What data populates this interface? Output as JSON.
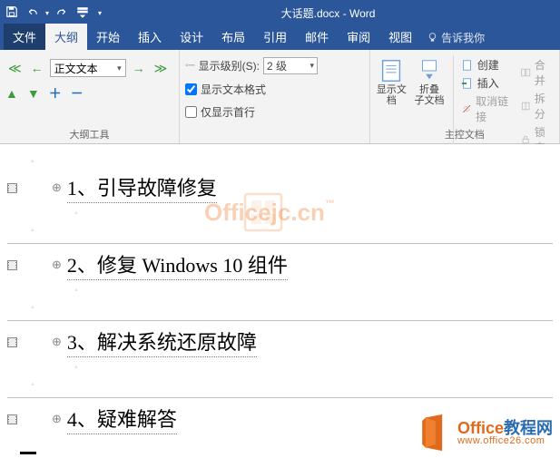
{
  "titlebar": {
    "title": "大话题.docx - Word"
  },
  "tabs": {
    "file": "文件",
    "outline": "大纲",
    "home": "开始",
    "insert": "插入",
    "design": "设计",
    "layout": "布局",
    "references": "引用",
    "mailings": "邮件",
    "review": "审阅",
    "view": "视图",
    "tellme": "告诉我你"
  },
  "ribbon": {
    "outline_tools": {
      "level_selector": "正文文本",
      "group_label": "大纲工具",
      "show_level_label": "显示级别(S):",
      "show_level_value": "2 级",
      "show_text_formatting": "显示文本格式",
      "show_first_line": "仅显示首行"
    },
    "master_doc": {
      "group_label": "主控文档",
      "show_doc": "显示文档",
      "collapse_sub_l1": "折叠",
      "collapse_sub_l2": "子文档",
      "create": "创建",
      "insert": "插入",
      "unlink": "取消链接",
      "merge": "合并",
      "split": "拆分",
      "lock": "锁定"
    }
  },
  "document": {
    "headings": [
      "1、引导故障修复",
      "2、修复 Windows 10 组件",
      "3、解决系统还原故障",
      "4、疑难解答"
    ]
  },
  "watermarks": {
    "center": "Officejc.cn",
    "footer_brand": "Office",
    "footer_brand_suffix": "教程网",
    "footer_url": "www.office26.com"
  }
}
